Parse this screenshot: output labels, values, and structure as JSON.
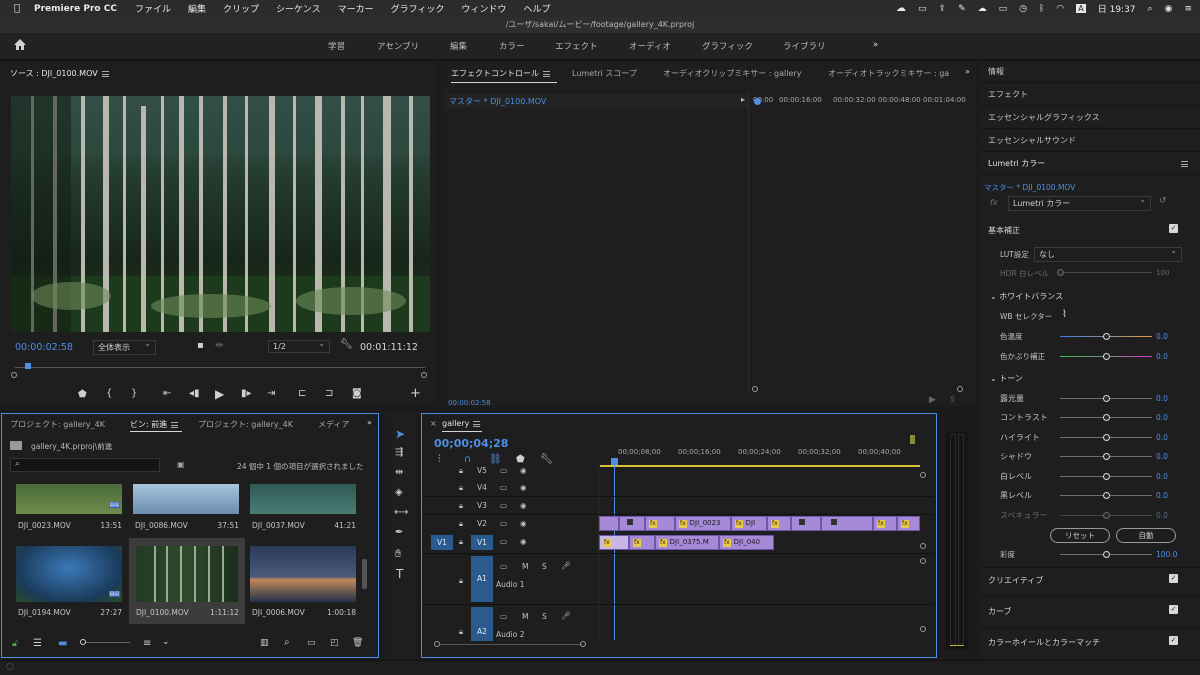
{
  "menubar": {
    "app_name": "Premiere Pro CC",
    "menus": [
      "ファイル",
      "編集",
      "クリップ",
      "シーケンス",
      "マーカー",
      "グラフィック",
      "ウィンドウ",
      "ヘルプ"
    ],
    "clock": "日 19:37",
    "input_mode": "A"
  },
  "title": "/ユーザ/sakai/ムービー/footage/gallery_4K.prproj",
  "workspaces": [
    "学習",
    "アセンブリ",
    "編集",
    "カラー",
    "エフェクト",
    "オーディオ",
    "グラフィック",
    "ライブラリ"
  ],
  "source": {
    "tab": "ソース : DJI_0100.MOV",
    "timecode": "00:00:02:58",
    "fit": "全体表示",
    "resolution": "1/2",
    "duration": "00:01:11:12"
  },
  "effect_controls": {
    "tabs": [
      "エフェクトコントロール",
      "Lumetri スコープ",
      "オーディオクリップミキサー : gallery",
      "オーディオトラックミキサー : ga"
    ],
    "master": "マスター * DJI_0100.MOV",
    "ruler": [
      "00:00",
      "00:00:16:00",
      "00:00:32:00",
      "00:00:48:00",
      "00:01:04:00"
    ],
    "timecode": "00:00:02:58"
  },
  "project": {
    "tabs": [
      "プロジェクト: gallery_4K",
      "ビン: 前進",
      "プロジェクト: gallery_4K",
      "メディア"
    ],
    "path": "gallery_4K.prproj\\前進",
    "status": "24 個中 1 個の項目が選択されました",
    "items": [
      {
        "name": "DJI_0023.MOV",
        "dur": "13:51",
        "color": "#4a6a3a"
      },
      {
        "name": "DJI_0086.MOV",
        "dur": "37:51",
        "color": "#7fa8c8"
      },
      {
        "name": "DJI_0037.MOV",
        "dur": "41:21",
        "color": "#3c6a60"
      },
      {
        "name": "DJI_0194.MOV",
        "dur": "27:27",
        "color": "#2a5a8a"
      },
      {
        "name": "DJI_0100.MOV",
        "dur": "1:11:12",
        "color": "#243622"
      },
      {
        "name": "DJI_0006.MOV",
        "dur": "1:00:18",
        "color": "#31476c"
      }
    ]
  },
  "timeline": {
    "tab": "gallery",
    "timecode": "00;00;04;28",
    "ruler": [
      "00;00;08;00",
      "00;00;16;00",
      "00;00;24;00",
      "00;00;32;00",
      "00;00;40;00"
    ],
    "tracks": [
      "V5",
      "V4",
      "V3",
      "V2",
      "V1",
      "A1",
      "A2"
    ],
    "source_patch": "V1",
    "audio_names": [
      "Audio 1",
      "Audio 2"
    ],
    "mute": "M",
    "solo": "S",
    "clips_v2": [
      "DJI_0023",
      "DJI"
    ],
    "clips_v1": [
      "DJI_0375.M",
      "DJI_040"
    ]
  },
  "right_panel": {
    "sections": [
      "情報",
      "エフェクト",
      "エッセンシャルグラフィックス",
      "エッセンシャルサウンド",
      "Lumetri カラー"
    ],
    "master": "マスター * DJI_0100.MOV",
    "fx_select": "Lumetri カラー",
    "basic": "基本補正",
    "lut_label": "LUT設定",
    "lut_value": "なし",
    "hdr_label": "HDR 白レベル",
    "hdr_value": "100",
    "hdr_level": 0,
    "wb_section": "ホワイトバランス",
    "wb_selector": "WB セレクター",
    "tone_section": "トーン",
    "sliders": [
      {
        "label": "色温度",
        "value": "0.0"
      },
      {
        "label": "色かぶり補正",
        "value": "0.0"
      },
      {
        "label": "露光量",
        "value": "0.0"
      },
      {
        "label": "コントラスト",
        "value": "0.0"
      },
      {
        "label": "ハイライト",
        "value": "0.0"
      },
      {
        "label": "シャドウ",
        "value": "0.0"
      },
      {
        "label": "白レベル",
        "value": "0.0"
      },
      {
        "label": "黒レベル",
        "value": "0.0"
      },
      {
        "label": "スペキュラー",
        "value": "0.0"
      }
    ],
    "reset": "リセット",
    "auto": "自動",
    "saturation_label": "彩度",
    "saturation_value": "100.0",
    "bottom": [
      "クリエイティブ",
      "カーブ",
      "カラーホイールとカラーマッチ"
    ]
  },
  "colors": {
    "accent": "#4e8fe3",
    "clip": "#a68ad8",
    "fx_badge": "#e6c84a",
    "playhead": "#4e8fe3"
  }
}
